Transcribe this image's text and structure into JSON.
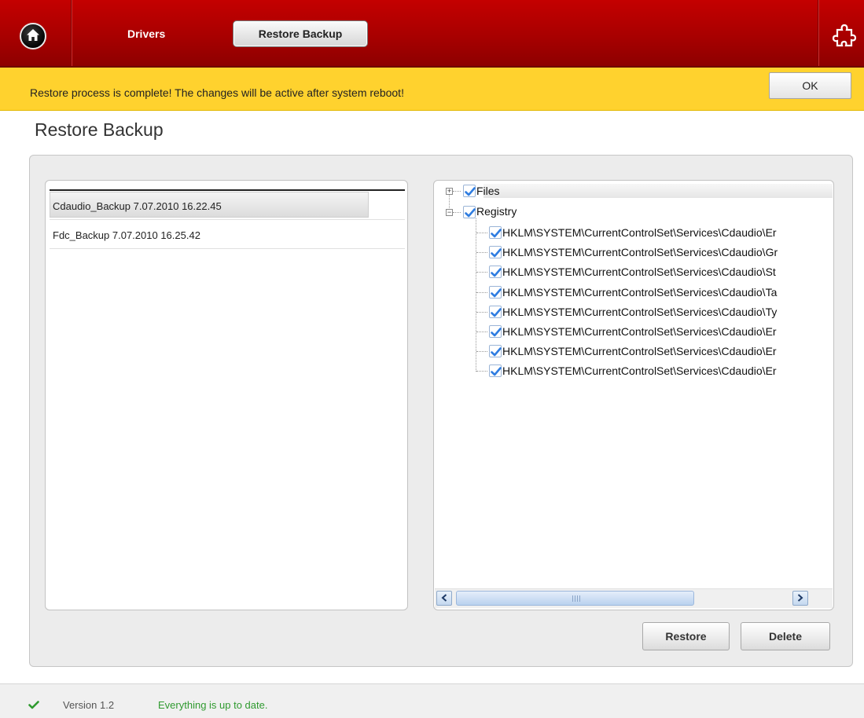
{
  "header": {
    "nav_drivers": "Drivers",
    "nav_restore_backup": "Restore Backup",
    "brand_color": "#b00000"
  },
  "notification": {
    "message": "Restore process is complete! The changes will be active after system reboot!",
    "ok_label": "OK",
    "color": "#ffd22e"
  },
  "page": {
    "title": "Restore Backup"
  },
  "backups": [
    {
      "label": "Cdaudio_Backup 7.07.2010 16.22.45",
      "selected": true
    },
    {
      "label": "Fdc_Backup 7.07.2010 16.25.42",
      "selected": false
    }
  ],
  "tree": {
    "files_label": "Files",
    "registry_label": "Registry",
    "registry_items": [
      "HKLM\\SYSTEM\\CurrentControlSet\\Services\\Cdaudio\\Er",
      "HKLM\\SYSTEM\\CurrentControlSet\\Services\\Cdaudio\\Gr",
      "HKLM\\SYSTEM\\CurrentControlSet\\Services\\Cdaudio\\St",
      "HKLM\\SYSTEM\\CurrentControlSet\\Services\\Cdaudio\\Ta",
      "HKLM\\SYSTEM\\CurrentControlSet\\Services\\Cdaudio\\Ty",
      "HKLM\\SYSTEM\\CurrentControlSet\\Services\\Cdaudio\\Er",
      "HKLM\\SYSTEM\\CurrentControlSet\\Services\\Cdaudio\\Er",
      "HKLM\\SYSTEM\\CurrentControlSet\\Services\\Cdaudio\\Er"
    ]
  },
  "actions": {
    "restore_label": "Restore",
    "delete_label": "Delete"
  },
  "status": {
    "version": "Version 1.2",
    "message": "Everything is up to date.",
    "ok_color": "#2f9a2f"
  },
  "icons": {
    "home": "home-icon",
    "plugin": "puzzle-icon",
    "check": "checkmark-icon",
    "scroll_left": "arrow-left-icon",
    "scroll_right": "arrow-right-icon"
  }
}
